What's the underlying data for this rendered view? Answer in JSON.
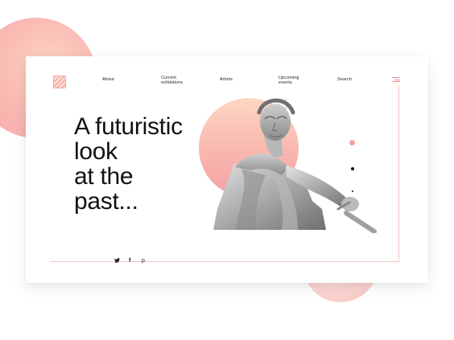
{
  "nav": {
    "items": [
      {
        "label": "About"
      },
      {
        "label": "Current exhibitions"
      },
      {
        "label": "Artists"
      },
      {
        "label": "Upcoming events"
      },
      {
        "label": "Search"
      }
    ]
  },
  "hero": {
    "headline_lines": [
      "A futuristic",
      "look",
      "at the",
      "past..."
    ]
  },
  "social": {
    "icons": [
      "twitter-icon",
      "facebook-icon",
      "pinterest-icon"
    ],
    "glyphs": [
      "🐦",
      "f",
      "p"
    ]
  },
  "colors": {
    "accent": "#f7a1a1",
    "blob": "#f9b3ad",
    "text": "#111111"
  },
  "menu": {
    "icon": "hamburger-icon"
  },
  "logo": {
    "icon": "logo-mark-icon"
  }
}
